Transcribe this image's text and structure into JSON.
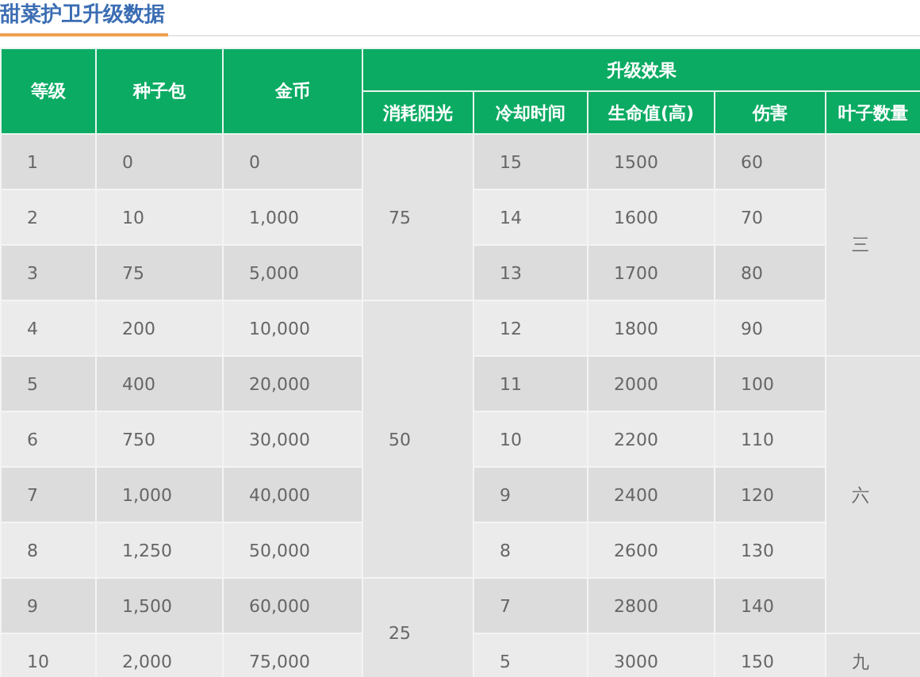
{
  "title": "甜菜护卫升级数据",
  "table": {
    "columns": [
      "等级",
      "种子包",
      "金币"
    ],
    "group_header": "升级效果",
    "group_columns": [
      "消耗阳光",
      "冷却时间",
      "生命值(高)",
      "伤害",
      "叶子数量"
    ],
    "rows": [
      {
        "level": "1",
        "seeds": "0",
        "coins": "0",
        "sunlight": "75",
        "cooldown": "15",
        "hp": "1500",
        "damage": "60",
        "leaves": "三"
      },
      {
        "level": "2",
        "seeds": "10",
        "coins": "1,000",
        "cooldown": "14",
        "hp": "1600",
        "damage": "70"
      },
      {
        "level": "3",
        "seeds": "75",
        "coins": "5,000",
        "cooldown": "13",
        "hp": "1700",
        "damage": "80"
      },
      {
        "level": "4",
        "seeds": "200",
        "coins": "10,000",
        "sunlight": "50",
        "cooldown": "12",
        "hp": "1800",
        "damage": "90"
      },
      {
        "level": "5",
        "seeds": "400",
        "coins": "20,000",
        "cooldown": "11",
        "hp": "2000",
        "damage": "100",
        "leaves": "六"
      },
      {
        "level": "6",
        "seeds": "750",
        "coins": "30,000",
        "cooldown": "10",
        "hp": "2200",
        "damage": "110"
      },
      {
        "level": "7",
        "seeds": "1,000",
        "coins": "40,000",
        "cooldown": "9",
        "hp": "2400",
        "damage": "120"
      },
      {
        "level": "8",
        "seeds": "1,250",
        "coins": "50,000",
        "cooldown": "8",
        "hp": "2600",
        "damage": "130"
      },
      {
        "level": "9",
        "seeds": "1,500",
        "coins": "60,000",
        "sunlight": "25",
        "cooldown": "7",
        "hp": "2800",
        "damage": "140"
      },
      {
        "level": "10",
        "seeds": "2,000",
        "coins": "75,000",
        "cooldown": "5",
        "hp": "3000",
        "damage": "150",
        "leaves": "九"
      }
    ]
  }
}
